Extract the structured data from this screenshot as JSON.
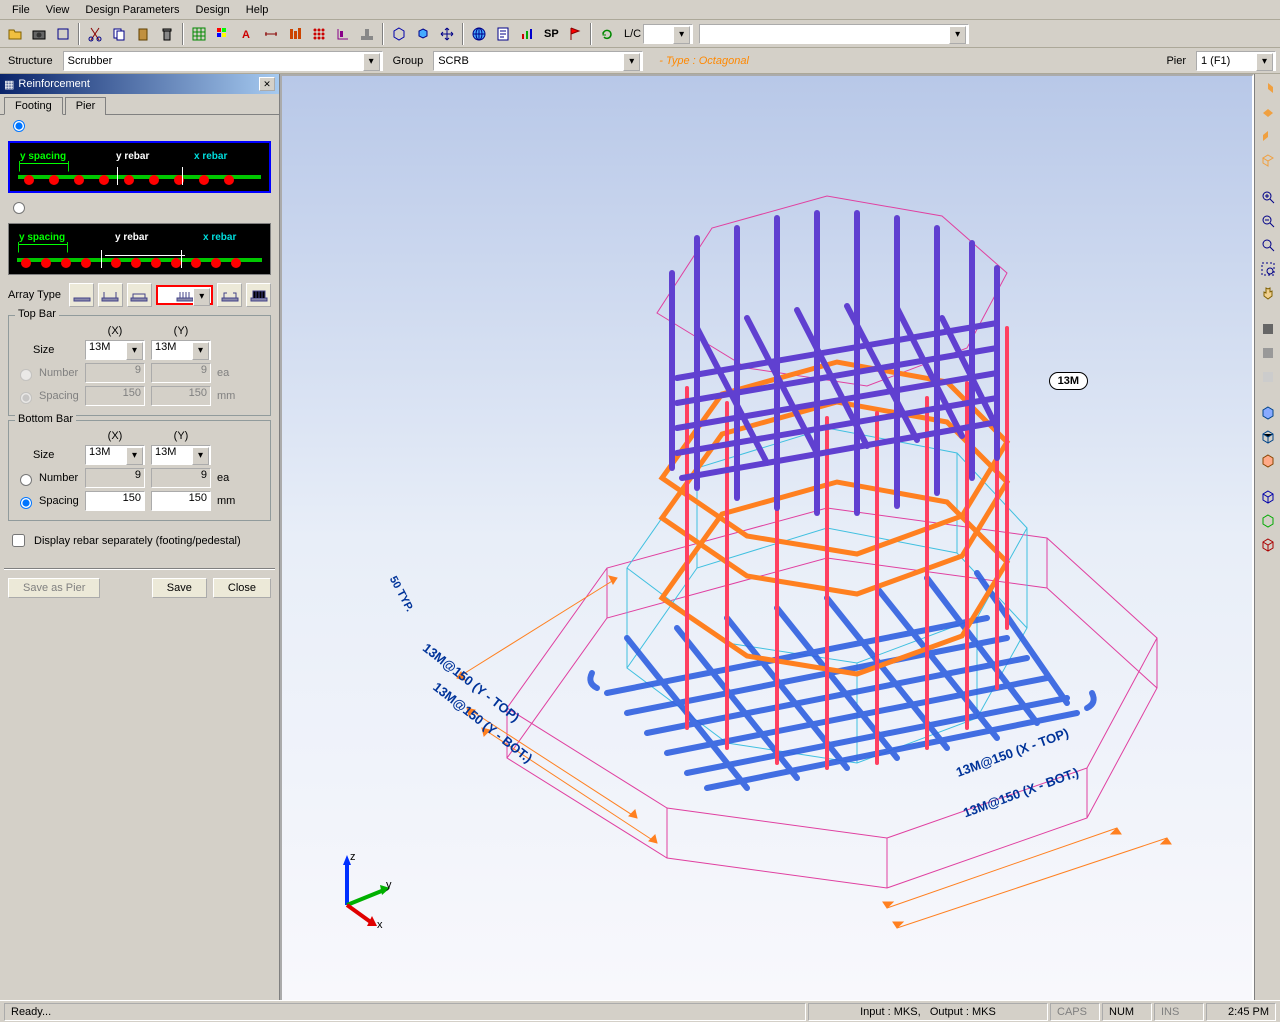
{
  "menu": {
    "file": "File",
    "view": "View",
    "design_params": "Design Parameters",
    "design": "Design",
    "help": "Help"
  },
  "toolbar": {
    "lc_label": "L/C"
  },
  "structure_bar": {
    "structure_label": "Structure",
    "structure_value": "Scrubber",
    "group_label": "Group",
    "group_value": "SCRB",
    "type_label": "- Type : Octagonal",
    "pier_label": "Pier",
    "pier_value": "1 (F1)"
  },
  "panel": {
    "title": "Reinforcement",
    "tabs": {
      "footing": "Footing",
      "pier": "Pier"
    },
    "diagram": {
      "y_spacing": "y spacing",
      "y_rebar": "y rebar",
      "x_rebar": "x rebar"
    },
    "array_type_label": "Array Type",
    "top_bar": {
      "title": "Top Bar",
      "x": "(X)",
      "y": "(Y)",
      "size_label": "Size",
      "size_x": "13M",
      "size_y": "13M",
      "number_label": "Number",
      "number_x": "9",
      "number_y": "9",
      "number_unit": "ea",
      "spacing_label": "Spacing",
      "spacing_x": "150",
      "spacing_y": "150",
      "spacing_unit": "mm"
    },
    "bottom_bar": {
      "title": "Bottom Bar",
      "x": "(X)",
      "y": "(Y)",
      "size_label": "Size",
      "size_x": "13M",
      "size_y": "13M",
      "number_label": "Number",
      "number_x": "9",
      "number_y": "9",
      "number_unit": "ea",
      "spacing_label": "Spacing",
      "spacing_x": "150",
      "spacing_y": "150",
      "spacing_unit": "mm"
    },
    "display_checkbox": "Display rebar separately (footing/pedestal)",
    "buttons": {
      "save_as_pier": "Save as Pier",
      "save": "Save",
      "close": "Close"
    }
  },
  "viewport": {
    "callout": "13M",
    "dim_x_top": "13M@150 (X - TOP)",
    "dim_x_bot": "13M@150 (X - BOT.)",
    "dim_y_top": "13M@150 (Y - TOP)",
    "dim_y_bot": "13M@150 (Y - BOT.)",
    "dim_50": "50 TYP.",
    "axis": {
      "x": "x",
      "y": "y",
      "z": "z"
    }
  },
  "status": {
    "ready": "Ready...",
    "input": "Input : MKS,",
    "output": "Output : MKS",
    "caps": "CAPS",
    "num": "NUM",
    "ins": "INS",
    "time": "2:45 PM"
  }
}
